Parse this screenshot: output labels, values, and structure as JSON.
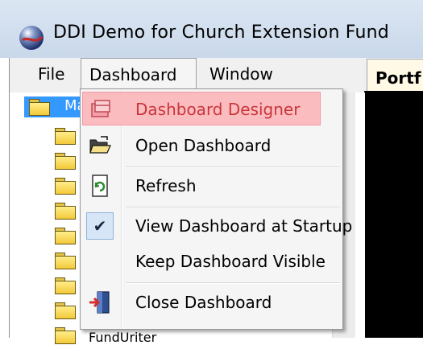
{
  "window": {
    "title": "DDI Demo for Church Extension Fund"
  },
  "menubar": {
    "items": [
      {
        "label": "File"
      },
      {
        "label": "Dashboard"
      },
      {
        "label": "Window"
      }
    ]
  },
  "tab": {
    "label": "Portf"
  },
  "tree": {
    "root_label": "Ma",
    "bottom_label": "FundUriter"
  },
  "dashboard_menu": {
    "items": [
      {
        "label": "Dashboard Designer",
        "icon": "dashboard-designer-icon",
        "highlighted": true
      },
      {
        "label": "Open Dashboard",
        "icon": "open-folder-icon"
      },
      {
        "label": "Refresh",
        "icon": "refresh-icon"
      },
      {
        "label": "View Dashboard at Startup",
        "icon": "checkmark-icon",
        "checked": true
      },
      {
        "label": "Keep Dashboard Visible",
        "icon": ""
      },
      {
        "label": "Close Dashboard",
        "icon": "exit-door-icon"
      }
    ]
  },
  "colors": {
    "highlight_bg": "#fbbcc0",
    "highlight_text": "#c8363b",
    "selection_blue": "#3399ff"
  }
}
